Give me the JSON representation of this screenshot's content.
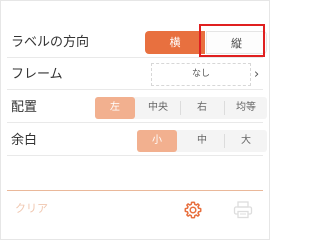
{
  "orientation": {
    "label": "ラベルの方向",
    "options": [
      "横",
      "縦"
    ],
    "selected": "横"
  },
  "frame": {
    "label": "フレーム",
    "value": "なし",
    "chevron": "›"
  },
  "alignment": {
    "label": "配置",
    "options": [
      "左",
      "中央",
      "右",
      "均等"
    ],
    "selected": "左"
  },
  "margin": {
    "label": "余白",
    "options": [
      "小",
      "中",
      "大"
    ],
    "selected": "小"
  },
  "footer": {
    "clear_label": "クリア",
    "settings_icon": "gear-icon",
    "print_icon": "printer-icon"
  },
  "colors": {
    "accent": "#e8703f",
    "accent_light": "#f2b08f",
    "highlight": "#e02020"
  }
}
